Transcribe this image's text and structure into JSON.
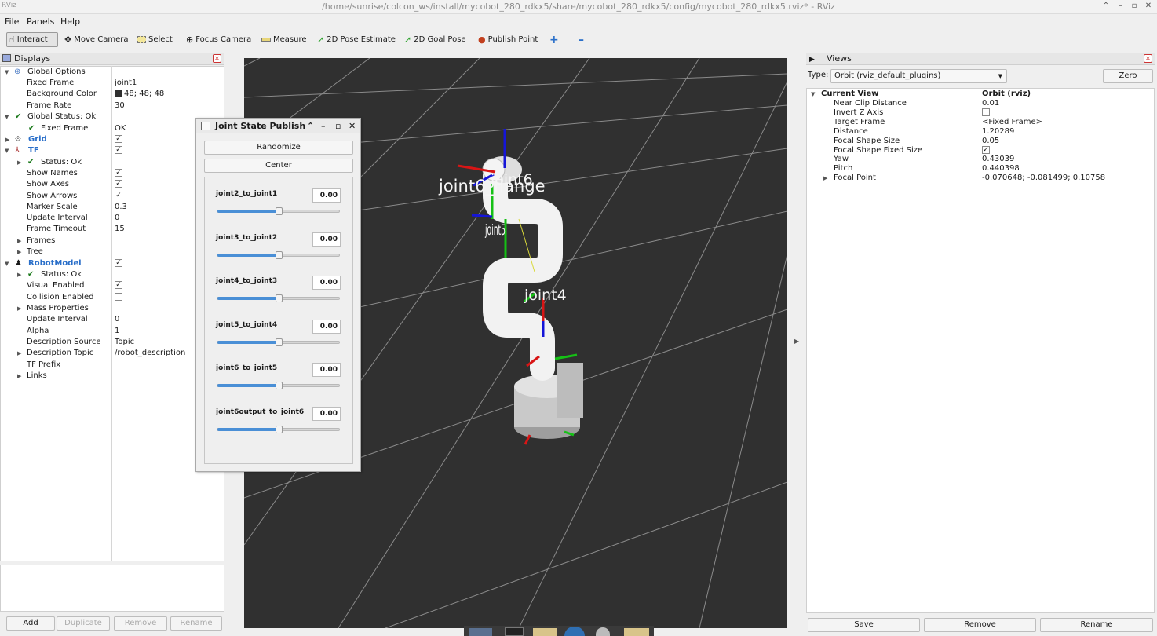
{
  "window": {
    "app_icon": "RViz",
    "title": "/home/sunrise/colcon_ws/install/mycobot_280_rdkx5/share/mycobot_280_rdkx5/config/mycobot_280_rdkx5.rviz* - RViz"
  },
  "menu": [
    "File",
    "Panels",
    "Help"
  ],
  "toolbar": [
    {
      "label": "Interact",
      "icon": "cursor-icon"
    },
    {
      "label": "Move Camera",
      "icon": "move-icon"
    },
    {
      "label": "Select",
      "icon": "select-icon"
    },
    {
      "label": "Focus Camera",
      "icon": "focus-icon"
    },
    {
      "label": "Measure",
      "icon": "ruler-icon"
    },
    {
      "label": "2D Pose Estimate",
      "icon": "pose-arrow-icon"
    },
    {
      "label": "2D Goal Pose",
      "icon": "goal-arrow-icon"
    },
    {
      "label": "Publish Point",
      "icon": "pin-icon"
    }
  ],
  "displays": {
    "title": "Displays",
    "rows": [
      {
        "key": "Global Options",
        "value": ""
      },
      {
        "key": "Fixed Frame",
        "value": "joint1"
      },
      {
        "key": "Background Color",
        "value": "48; 48; 48"
      },
      {
        "key": "Frame Rate",
        "value": "30"
      },
      {
        "key": "Global Status: Ok",
        "value": ""
      },
      {
        "key": "Fixed Frame",
        "value": "OK"
      },
      {
        "key": "Grid",
        "value": ""
      },
      {
        "key": "TF",
        "value": ""
      },
      {
        "key": "Status: Ok",
        "value": ""
      },
      {
        "key": "Show Names",
        "value": ""
      },
      {
        "key": "Show Axes",
        "value": ""
      },
      {
        "key": "Show Arrows",
        "value": ""
      },
      {
        "key": "Marker Scale",
        "value": "0.3"
      },
      {
        "key": "Update Interval",
        "value": "0"
      },
      {
        "key": "Frame Timeout",
        "value": "15"
      },
      {
        "key": "Frames",
        "value": ""
      },
      {
        "key": "Tree",
        "value": ""
      },
      {
        "key": "RobotModel",
        "value": ""
      },
      {
        "key": "Status: Ok",
        "value": ""
      },
      {
        "key": "Visual Enabled",
        "value": ""
      },
      {
        "key": "Collision Enabled",
        "value": ""
      },
      {
        "key": "Mass Properties",
        "value": ""
      },
      {
        "key": "Update Interval",
        "value": "0"
      },
      {
        "key": "Alpha",
        "value": "1"
      },
      {
        "key": "Description Source",
        "value": "Topic"
      },
      {
        "key": "Description Topic",
        "value": "/robot_description"
      },
      {
        "key": "TF Prefix",
        "value": ""
      },
      {
        "key": "Links",
        "value": ""
      }
    ],
    "buttons": {
      "add": "Add",
      "duplicate": "Duplicate",
      "remove": "Remove",
      "rename": "Rename"
    }
  },
  "jsp": {
    "title": "Joint State Publisher",
    "randomize": "Randomize",
    "center": "Center",
    "joints": [
      {
        "name": "joint2_to_joint1",
        "value": "0.00",
        "fraction": 0.5
      },
      {
        "name": "joint3_to_joint2",
        "value": "0.00",
        "fraction": 0.5
      },
      {
        "name": "joint4_to_joint3",
        "value": "0.00",
        "fraction": 0.5
      },
      {
        "name": "joint5_to_joint4",
        "value": "0.00",
        "fraction": 0.5
      },
      {
        "name": "joint6_to_joint5",
        "value": "0.00",
        "fraction": 0.5
      },
      {
        "name": "joint6output_to_joint6",
        "value": "0.00",
        "fraction": 0.5
      }
    ]
  },
  "viewport": {
    "background": "#303030",
    "labels": [
      "joint6_flange",
      "joint5",
      "joint4",
      "joint6"
    ]
  },
  "views": {
    "title": "Views",
    "type_label": "Type:",
    "type_value": "Orbit (rviz_default_plugins)",
    "zero": "Zero",
    "header_key": "Current View",
    "header_value": "Orbit (rviz)",
    "rows": [
      {
        "key": "Near Clip Distance",
        "value": "0.01"
      },
      {
        "key": "Invert Z Axis",
        "value": ""
      },
      {
        "key": "Target Frame",
        "value": "<Fixed Frame>"
      },
      {
        "key": "Distance",
        "value": "1.20289"
      },
      {
        "key": "Focal Shape Size",
        "value": "0.05"
      },
      {
        "key": "Focal Shape Fixed Size",
        "value": ""
      },
      {
        "key": "Yaw",
        "value": "0.43039"
      },
      {
        "key": "Pitch",
        "value": "0.440398"
      },
      {
        "key": "Focal Point",
        "value": "-0.070648; -0.081499; 0.10758"
      }
    ],
    "buttons": {
      "save": "Save",
      "remove": "Remove",
      "rename": "Rename"
    }
  }
}
